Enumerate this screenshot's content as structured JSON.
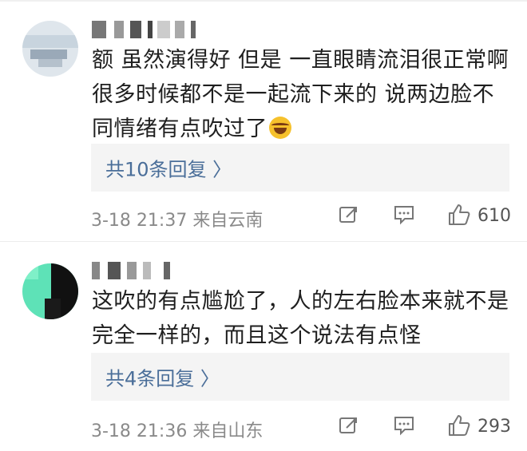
{
  "comments": [
    {
      "text_line1": "额 虽然演得好 但是 一直眼睛流泪很正常啊",
      "text_line2": "很多时候都不是一起流下来的 说两边脸不",
      "text_line3": "同情绪有点吹过了",
      "emoji": "laughing-tears-emoji",
      "replies_label": "共10条回复 〉",
      "meta": "3-18 21:37 来自云南",
      "likes": "610"
    },
    {
      "text_line1": "这吹的有点尴尬了，人的左右脸本来就不是",
      "text_line2": "完全一样的，而且这个说法有点怪",
      "replies_label": "共4条回复 〉",
      "meta": "3-18 21:36 来自山东",
      "likes": "293"
    }
  ],
  "icons": [
    "share-icon",
    "comment-icon",
    "like-icon"
  ],
  "colors": {
    "link": "#4a6e99",
    "reply_bg": "#f4f4f4",
    "meta": "#8a8a8a"
  }
}
